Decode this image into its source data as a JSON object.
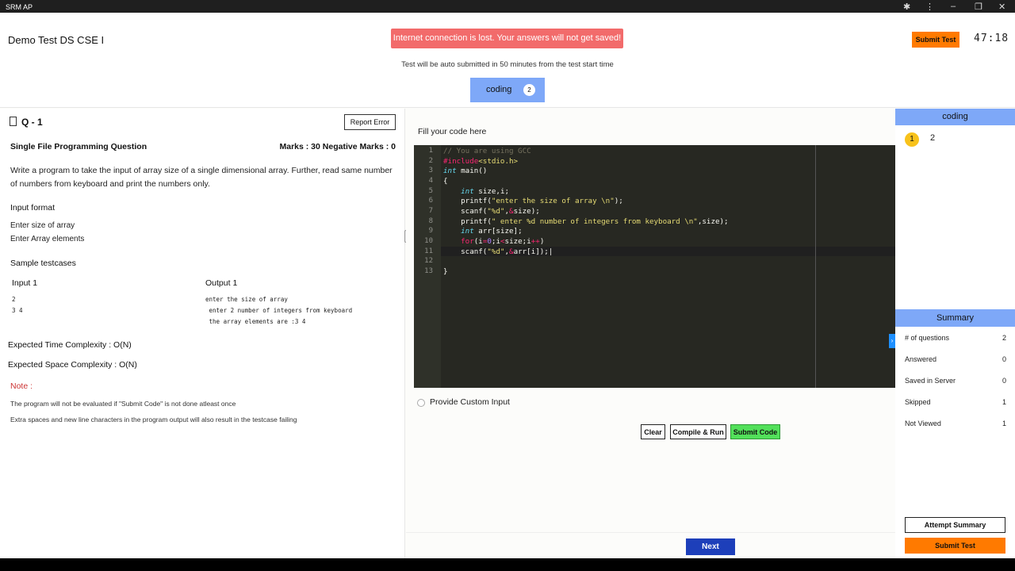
{
  "window": {
    "title": "SRM AP"
  },
  "header": {
    "test_title": "Demo Test DS CSE I",
    "alert": "Internet connection is lost. Your answers will not get saved!",
    "submit_label": "Submit Test",
    "timer": "47:18",
    "auto_submit_note": "Test will be auto submitted in 50 minutes from the test start time",
    "section_tab": {
      "label": "coding",
      "count": "2"
    }
  },
  "question": {
    "number": "Q - 1",
    "report_label": "Report Error",
    "type": "Single File Programming Question",
    "marks": "Marks : 30  Negative Marks : 0",
    "description": "Write a program to take the input of array size of a single dimensional array. Further, read same number of numbers from keyboard and print the numbers only.",
    "input_format_heading": "Input format",
    "input_format_lines": [
      "Enter size of array",
      "Enter Array elements"
    ],
    "sample_heading": "Sample testcases",
    "sample_input_heading": "Input 1",
    "sample_output_heading": "Output 1",
    "sample_input_lines": [
      "2",
      "3 4"
    ],
    "sample_output_lines": [
      "enter the size of array",
      " enter 2 number of integers from keyboard",
      " the array elements are :3 4"
    ],
    "time_complexity": "Expected Time Complexity : O(N)",
    "space_complexity": "Expected Space Complexity : O(N)",
    "note_heading": "Note :",
    "notes": [
      "The program will not be evaluated if \"Submit Code\" is not done atleast once",
      "Extra spaces and new line characters in the program output will also result in the testcase failing"
    ]
  },
  "editor": {
    "label": "Fill your code here",
    "line_numbers": [
      "1",
      "2",
      "3",
      "4",
      "5",
      "6",
      "7",
      "8",
      "9",
      "10",
      "11",
      "12",
      "13"
    ],
    "custom_input_label": "Provide Custom Input",
    "clear_label": "Clear",
    "compile_label": "Compile & Run",
    "submit_code_label": "Submit Code",
    "next_label": "Next"
  },
  "sidebar": {
    "section_title": "coding",
    "questions": [
      "1",
      "2"
    ],
    "summary_title": "Summary",
    "summary": [
      {
        "label": "# of questions",
        "value": "2"
      },
      {
        "label": "Answered",
        "value": "0"
      },
      {
        "label": "Saved in Server",
        "value": "0"
      },
      {
        "label": "Skipped",
        "value": "1"
      },
      {
        "label": "Not Viewed",
        "value": "1"
      }
    ],
    "attempt_summary_label": "Attempt Summary",
    "submit_label": "Submit Test"
  },
  "colors": {
    "accent": "#7ea8f8",
    "submit": "#ff7a00",
    "alert": "#f26b6b",
    "submit_code": "#52e05a",
    "next": "#1d3fba"
  }
}
